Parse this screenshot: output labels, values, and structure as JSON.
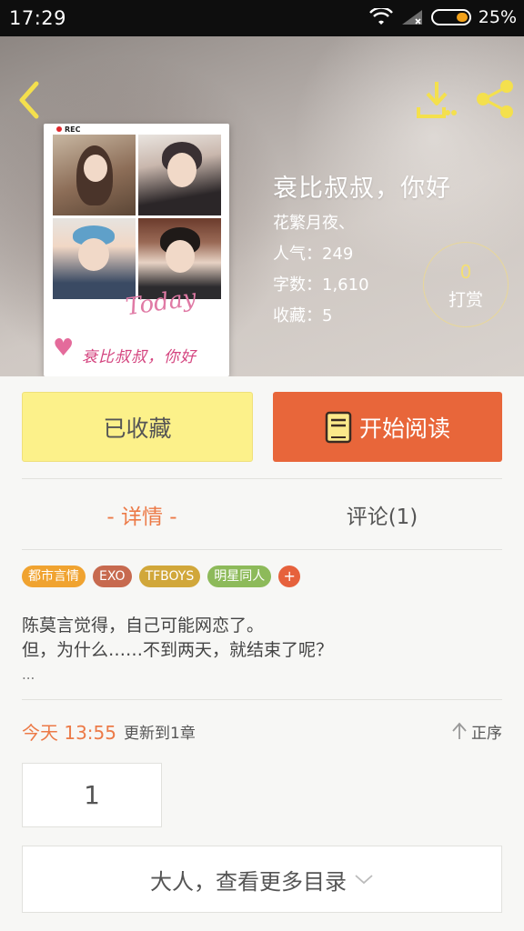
{
  "status_bar": {
    "time": "17:29",
    "battery": "25%"
  },
  "book": {
    "title": "衰比叔叔，你好",
    "author": "花繁月夜、",
    "popularity": "人气：249",
    "word_count": "字数：1,610",
    "favorites": "收藏：5",
    "cover": {
      "rec_label": "REC",
      "scribble": "Today",
      "title_art": "衰比叔叔，你好"
    }
  },
  "tip": {
    "count": "0",
    "label": "打赏"
  },
  "actions": {
    "favorite_label": "已收藏",
    "read_label": "开始阅读"
  },
  "tabs": [
    {
      "label": "- 详情 -"
    },
    {
      "label": "评论(1)"
    }
  ],
  "tags": [
    {
      "label": "都市言情",
      "color": "#f0a330"
    },
    {
      "label": "EXO",
      "color": "#c76a4f"
    },
    {
      "label": "TFBOYS",
      "color": "#d1a73a"
    },
    {
      "label": "明星同人",
      "color": "#8dba5a"
    }
  ],
  "tag_more": "+",
  "description": {
    "line1": "陈莫言觉得，自己可能网恋了。",
    "line2": "但，为什么……不到两天，就结束了呢？",
    "ellipsis": "..."
  },
  "update": {
    "time": "今天 13:55",
    "text": "更新到1章",
    "sort_label": "正序"
  },
  "chapter": {
    "number": "1"
  },
  "catalog": {
    "label": "大人，查看更多目录"
  },
  "colors": {
    "accent": "#e8663a",
    "favorite_bg": "#fcf18a",
    "header_icon": "#f4e04d"
  }
}
